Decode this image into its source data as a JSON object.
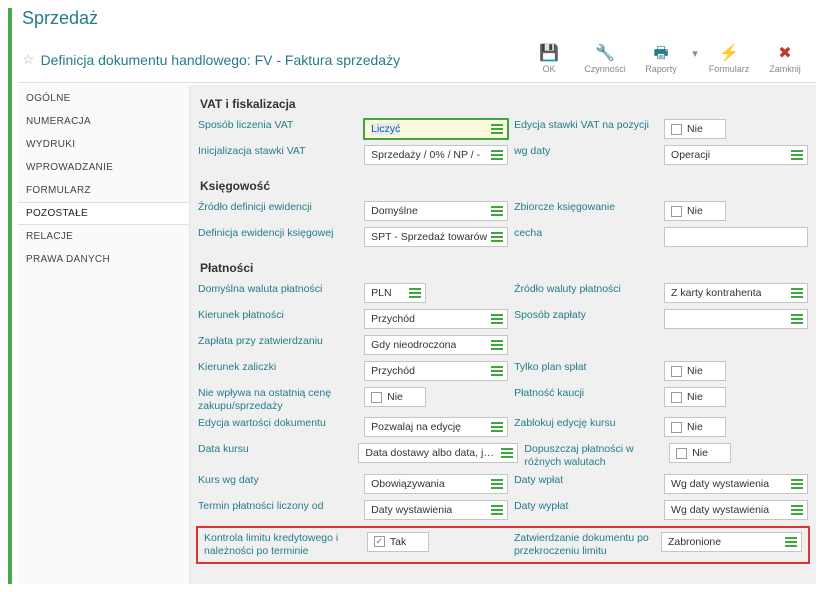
{
  "page_title": "Sprzedaż",
  "doc_title": "Definicja dokumentu handlowego: FV - Faktura sprzedaży",
  "toolbar": {
    "ok": "OK",
    "actions": "Czynności",
    "reports": "Raporty",
    "form": "Formularz",
    "close": "Zamknij"
  },
  "sidebar": {
    "items": [
      "OGÓLNE",
      "NUMERACJA",
      "WYDRUKI",
      "WPROWADZANIE",
      "FORMULARZ",
      "POZOSTAŁE",
      "RELACJE",
      "PRAWA DANYCH"
    ],
    "active_index": 5
  },
  "sections": {
    "vat": {
      "title": "VAT i fiskalizacja",
      "vat_method_label": "Sposób liczenia VAT",
      "vat_method_value": "Liczyć",
      "edit_vat_pos_label": "Edycja stawki VAT na pozycji",
      "edit_vat_pos_value": "Nie",
      "vat_init_label": "Inicjalizacja stawki VAT",
      "vat_init_value": "Sprzedaży / 0% / NP / -",
      "by_date_label": "wg daty",
      "by_date_value": "Operacji"
    },
    "accounting": {
      "title": "Księgowość",
      "src_def_label": "Źródło definicji ewidencji",
      "src_def_value": "Domyślne",
      "bulk_book_label": "Zbiorcze księgowanie",
      "bulk_book_value": "Nie",
      "acct_def_label": "Definicja ewidencji księgowej",
      "acct_def_value": "SPT - Sprzedaż towarów",
      "feature_label": "cecha",
      "feature_value": ""
    },
    "payments": {
      "title": "Płatności",
      "currency_label": "Domyślna waluta płatności",
      "currency_value": "PLN",
      "currency_src_label": "Źródło waluty płatności",
      "currency_src_value": "Z karty kontrahenta",
      "direction_label": "Kierunek płatności",
      "direction_value": "Przychód",
      "pay_method_label": "Sposób zapłaty",
      "pay_method_value": "",
      "pay_on_approve_label": "Zapłata przy zatwierdzaniu",
      "pay_on_approve_value": "Gdy nieodroczona",
      "advance_dir_label": "Kierunek zaliczki",
      "advance_dir_value": "Przychód",
      "only_plan_label": "Tylko plan spłat",
      "only_plan_value": "Nie",
      "no_effect_label": "Nie wpływa na ostatnią cenę zakupu/sprzedaży",
      "no_effect_value": "Nie",
      "deposit_label": "Płatność kaucji",
      "deposit_value": "Nie",
      "edit_value_label": "Edycja wartości dokumentu",
      "edit_value_value": "Pozwalaj na edycję",
      "block_rate_label": "Zablokuj edycję kursu",
      "block_rate_value": "Nie",
      "rate_date_label": "Data kursu",
      "rate_date_value": "Data dostawy albo data, jeśli",
      "multi_curr_label": "Dopuszczaj płatności w różnych walutach",
      "multi_curr_value": "Nie",
      "rate_by_date_label": "Kurs wg daty",
      "rate_by_date_value": "Obowiązywania",
      "in_dates_label": "Daty wpłat",
      "in_dates_value": "Wg daty wystawienia",
      "term_from_label": "Termin płatności liczony od",
      "term_from_value": "Daty wystawienia",
      "out_dates_label": "Daty wypłat",
      "out_dates_value": "Wg daty wystawienia",
      "credit_chk_label": "Kontrola limitu kredytowego i należności po terminie",
      "credit_chk_value": "Tak",
      "approve_over_label": "Zatwierdzanie dokumentu  po przekroczeniu limitu",
      "approve_over_value": "Zabronione"
    }
  }
}
